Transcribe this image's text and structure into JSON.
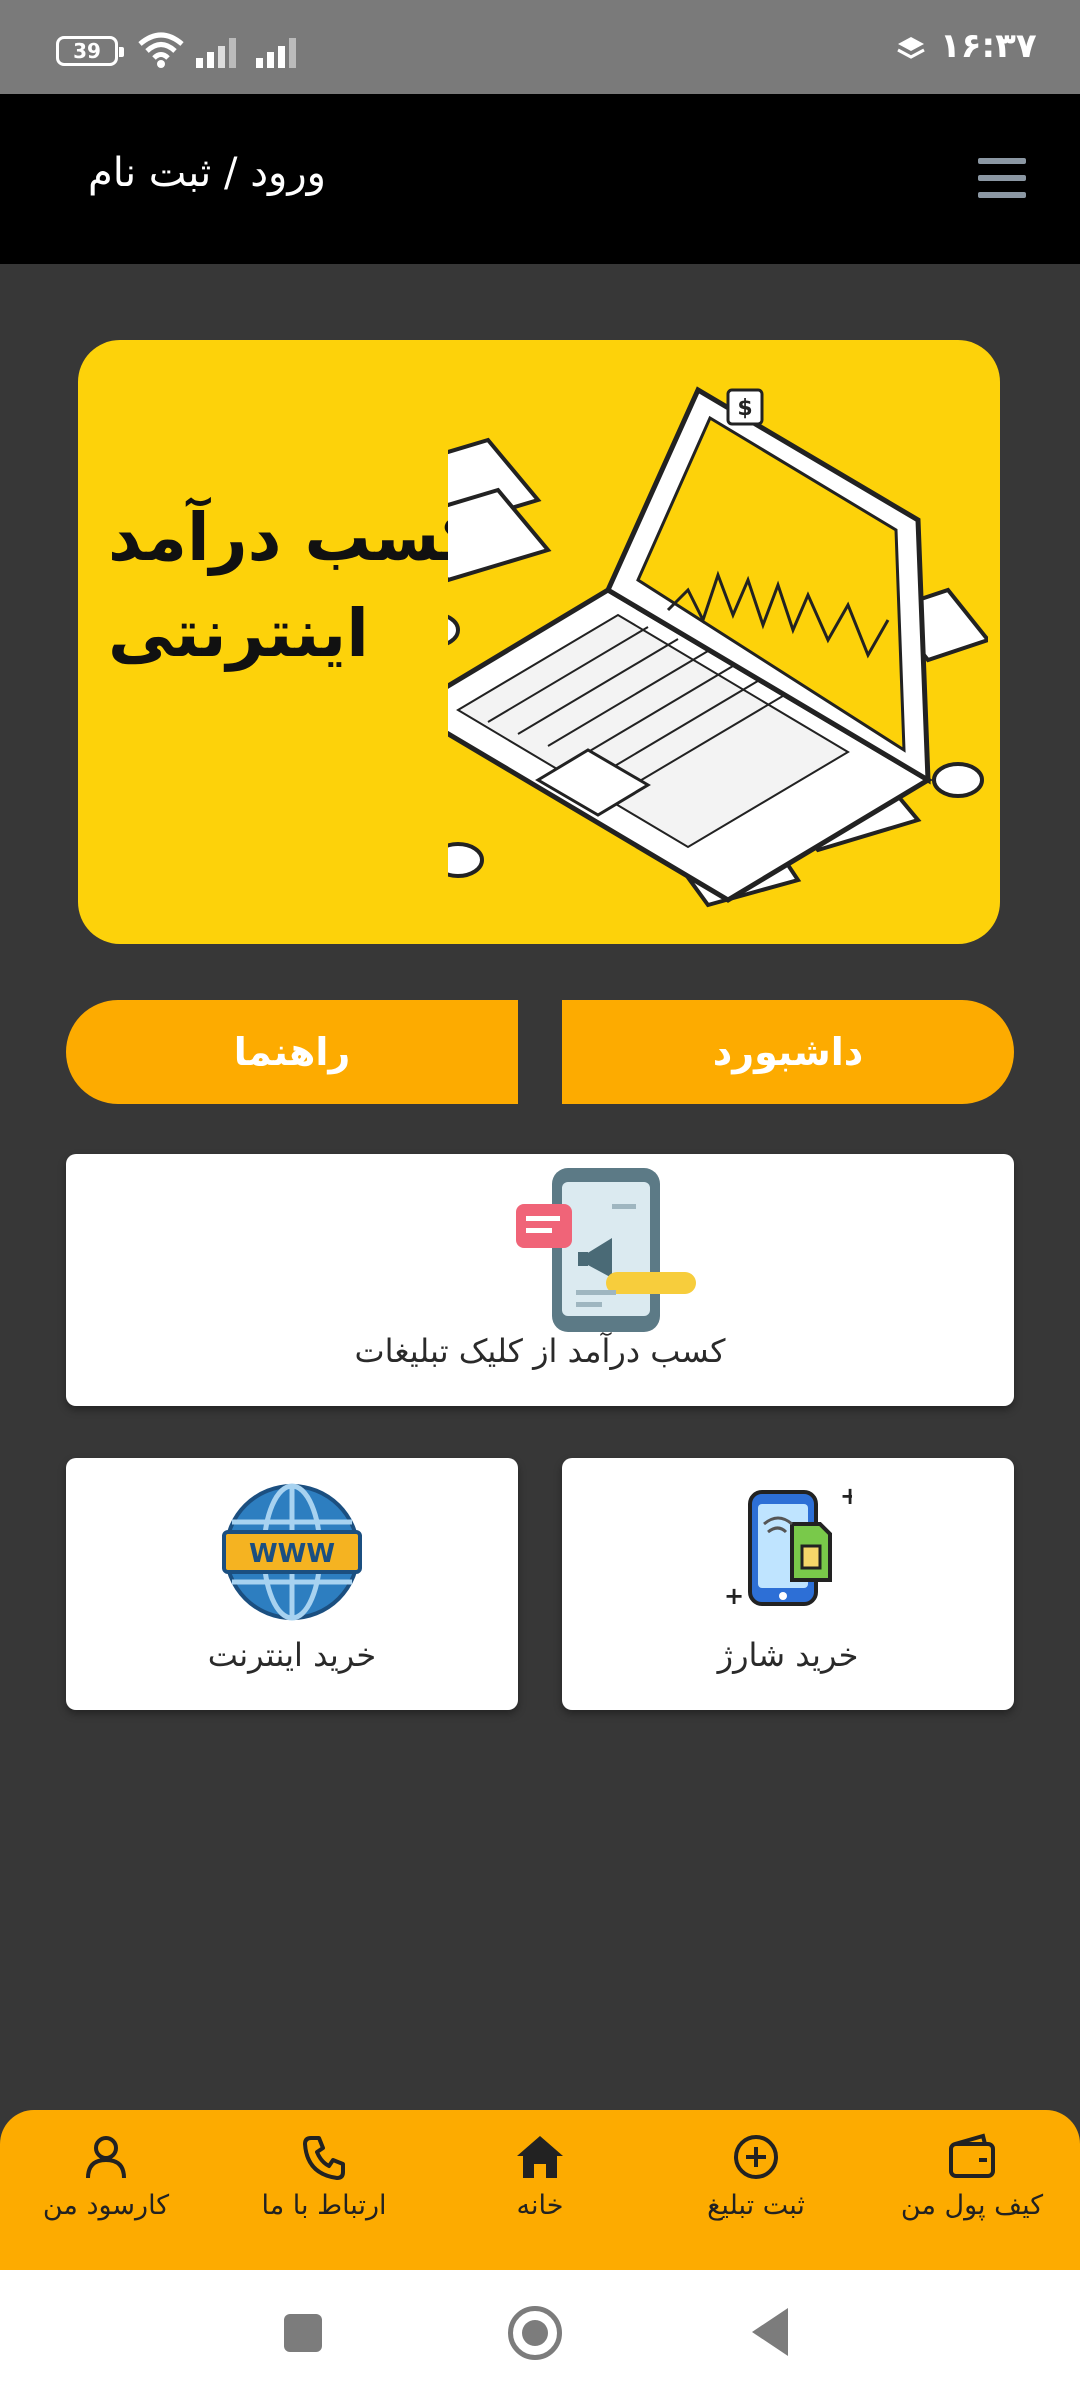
{
  "status_bar": {
    "battery": "39",
    "time": "۱۶:۳۷",
    "icons": [
      "wifi-icon",
      "signal-icon",
      "signal-icon",
      "layers-icon"
    ]
  },
  "header": {
    "login_label": "ورود / ثبت نام",
    "menu_icon": "hamburger-menu-icon"
  },
  "banner": {
    "headline_line1": "کسب درآمد",
    "headline_line2": "اینترنتی"
  },
  "buttons": {
    "guide_label": "راهنما",
    "dashboard_label": "داشبورد"
  },
  "cards": {
    "ads_label": "کسب درآمد از کلیک تبلیغات",
    "internet_label": "خرید اینترنت",
    "charge_label": "خرید شارژ",
    "www_text": "WWW"
  },
  "bottom_nav": {
    "items": [
      {
        "label": "کارسود من",
        "icon": "user-icon"
      },
      {
        "label": "ارتباط با ما",
        "icon": "phone-icon"
      },
      {
        "label": "خانه",
        "icon": "home-icon"
      },
      {
        "label": "ثبت تبلیغ",
        "icon": "plus-circle-icon"
      },
      {
        "label": "کیف پول من",
        "icon": "wallet-icon"
      }
    ]
  },
  "colors": {
    "accent": "#fdab00",
    "banner_bg": "#fdd20a",
    "page_bg": "#373737",
    "header_bg": "#000000"
  }
}
